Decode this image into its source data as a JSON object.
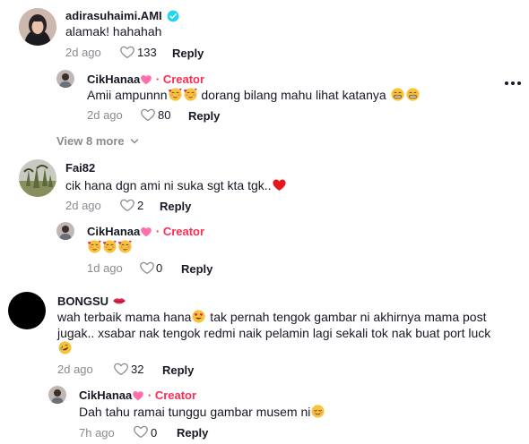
{
  "colors": {
    "creator": "#fe2c55",
    "muted": "#8a8b91",
    "text": "#161823",
    "verified": "#20d5ec"
  },
  "comments": [
    {
      "username": "adirasuhaimi.AMI",
      "text": "alamak! hahahah",
      "time": "2d ago",
      "likes": "133",
      "reply_label": "Reply",
      "verified": true,
      "reply": {
        "username": "CikHanaa",
        "creator_label": "· Creator",
        "text_before": "Amii ampunnn",
        "text_after": " dorang bilang mahu lihat katanya",
        "time": "2d ago",
        "likes": "80",
        "reply_label": "Reply"
      },
      "view_more": "View 8 more"
    },
    {
      "username": "Fai82",
      "text": "cik hana dgn ami ni suka sgt kta tgk..",
      "time": "2d ago",
      "likes": "2",
      "reply_label": "Reply",
      "reply": {
        "username": "CikHanaa",
        "creator_label": "· Creator",
        "time": "1d ago",
        "likes": "0",
        "reply_label": "Reply"
      }
    },
    {
      "username": "BONGSU",
      "text_line1_a": "wah terbaik mama hana",
      "text_line1_b": " tak pernah tengok gambar ni akhirnya mama post",
      "text_line2": "jugak.. xsabar nak tengok redmi naik pelamin lagi sekali tok nak buat port luck",
      "time": "2d ago",
      "likes": "32",
      "reply_label": "Reply",
      "reply": {
        "username": "CikHanaa",
        "creator_label": "· Creator",
        "text": "Dah tahu ramai tunggu gambar musem ni",
        "time": "7h ago",
        "likes": "0",
        "reply_label": "Reply"
      }
    }
  ],
  "icons": {
    "more": "more-options-icon",
    "like": "heart-outline-icon",
    "chevron": "chevron-down-icon"
  }
}
